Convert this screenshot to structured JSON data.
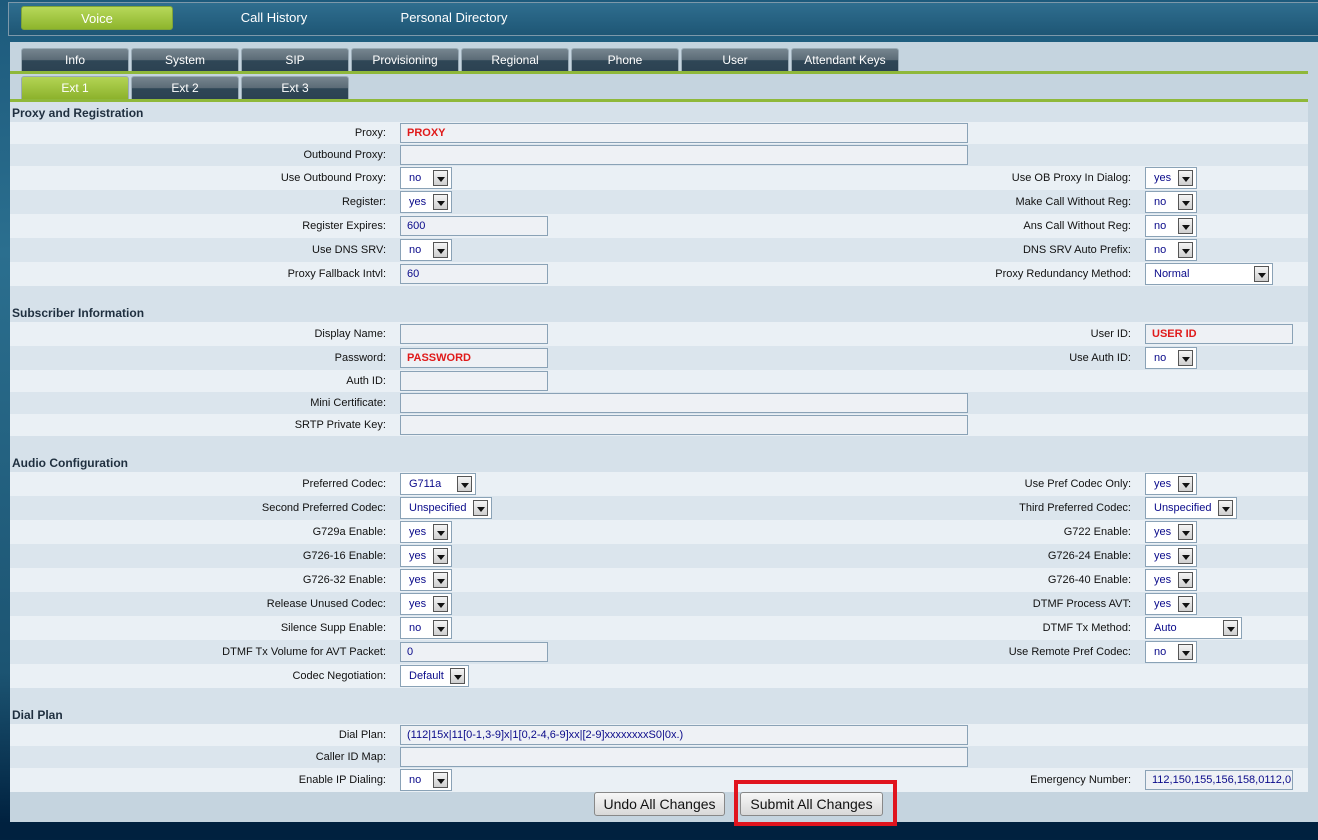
{
  "topnav": [
    "Voice",
    "Call History",
    "Personal Directory"
  ],
  "tabs": [
    "Info",
    "System",
    "SIP",
    "Provisioning",
    "Regional",
    "Phone",
    "User",
    "Attendant Keys"
  ],
  "subtabs": [
    "Ext 1",
    "Ext 2",
    "Ext 3"
  ],
  "sections": [
    {
      "title": "Proxy and Registration",
      "rows": [
        {
          "l": [
            "Proxy:",
            "input-long",
            "PROXY",
            true
          ]
        },
        {
          "l": [
            "Outbound Proxy:",
            "input-long",
            ""
          ]
        },
        {
          "l": [
            "Use Outbound Proxy:",
            "select",
            "no"
          ],
          "r": [
            "Use OB Proxy In Dialog:",
            "select",
            "yes"
          ]
        },
        {
          "l": [
            "Register:",
            "select",
            "yes"
          ],
          "r": [
            "Make Call Without Reg:",
            "select",
            "no"
          ]
        },
        {
          "l": [
            "Register Expires:",
            "input-short",
            "600"
          ],
          "r": [
            "Ans Call Without Reg:",
            "select",
            "no"
          ]
        },
        {
          "l": [
            "Use DNS SRV:",
            "select",
            "no"
          ],
          "r": [
            "DNS SRV Auto Prefix:",
            "select",
            "no"
          ]
        },
        {
          "l": [
            "Proxy Fallback Intvl:",
            "input-short",
            "60"
          ],
          "r": [
            "Proxy Redundancy Method:",
            "select",
            "Normal"
          ]
        }
      ]
    },
    {
      "title": "Subscriber Information",
      "rows": [
        {
          "l": [
            "Display Name:",
            "input-short",
            ""
          ],
          "r": [
            "User ID:",
            "input-short",
            "USER ID",
            true
          ]
        },
        {
          "l": [
            "Password:",
            "input-short",
            "PASSWORD",
            true
          ],
          "r": [
            "Use Auth ID:",
            "select",
            "no"
          ]
        },
        {
          "l": [
            "Auth ID:",
            "input-short",
            ""
          ]
        },
        {
          "l": [
            "Mini Certificate:",
            "input-long",
            ""
          ]
        },
        {
          "l": [
            "SRTP Private Key:",
            "input-long",
            ""
          ]
        }
      ]
    },
    {
      "title": "Audio Configuration",
      "rows": [
        {
          "l": [
            "Preferred Codec:",
            "select",
            "G711a"
          ],
          "r": [
            "Use Pref Codec Only:",
            "select",
            "yes"
          ]
        },
        {
          "l": [
            "Second Preferred Codec:",
            "select",
            "Unspecified"
          ],
          "r": [
            "Third Preferred Codec:",
            "select",
            "Unspecified"
          ]
        },
        {
          "l": [
            "G729a Enable:",
            "select",
            "yes"
          ],
          "r": [
            "G722 Enable:",
            "select",
            "yes"
          ]
        },
        {
          "l": [
            "G726-16 Enable:",
            "select",
            "yes"
          ],
          "r": [
            "G726-24 Enable:",
            "select",
            "yes"
          ]
        },
        {
          "l": [
            "G726-32 Enable:",
            "select",
            "yes"
          ],
          "r": [
            "G726-40 Enable:",
            "select",
            "yes"
          ]
        },
        {
          "l": [
            "Release Unused Codec:",
            "select",
            "yes"
          ],
          "r": [
            "DTMF Process AVT:",
            "select",
            "yes"
          ]
        },
        {
          "l": [
            "Silence Supp Enable:",
            "select",
            "no"
          ],
          "r": [
            "DTMF Tx Method:",
            "select",
            "Auto"
          ]
        },
        {
          "l": [
            "DTMF Tx Volume for AVT Packet:",
            "input-short",
            "0"
          ],
          "r": [
            "Use Remote Pref Codec:",
            "select",
            "no"
          ]
        },
        {
          "l": [
            "Codec Negotiation:",
            "select",
            "Default"
          ]
        }
      ]
    },
    {
      "title": "Dial Plan",
      "rows": [
        {
          "l": [
            "Dial Plan:",
            "input-long",
            "(112|15x|11[0-1,3-9]x|1[0,2-4,6-9]xx|[2-9]xxxxxxxxS0|0x.)"
          ]
        },
        {
          "l": [
            "Caller ID Map:",
            "input-long",
            ""
          ]
        },
        {
          "l": [
            "Enable IP Dialing:",
            "select",
            "no"
          ],
          "r": [
            "Emergency Number:",
            "input-short",
            "112,150,155,156,158,0112,0"
          ]
        }
      ]
    }
  ],
  "buttons": {
    "undo": "Undo All Changes",
    "submit": "Submit All Changes"
  },
  "colors": {
    "accent": "#8fb83a",
    "highlight": "#e0141e",
    "value_text": "#0a0a8a",
    "required_text": "#e01a1a"
  }
}
